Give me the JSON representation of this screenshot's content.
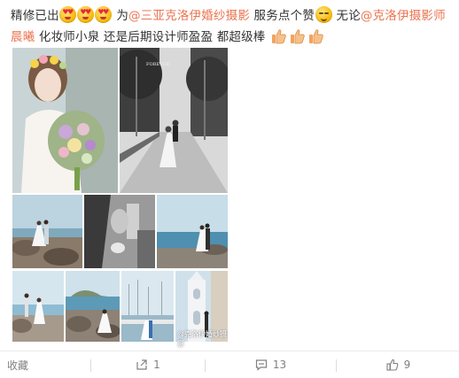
{
  "post": {
    "t1": "精修已出",
    "t2": "为",
    "mention1": "@三亚克洛伊婚纱摄影",
    "t3": "服务点个赞",
    "t4": "无论",
    "mention2": "@克洛伊摄影师晨曦",
    "t5": "化妆师小泉 还是后期设计师盈盈 都超级棒"
  },
  "icons": {
    "emoji": "heart-eyes-emoji",
    "smug": "smug-face-emoji",
    "thumb": "thumbs-up-emoji"
  },
  "watermark": "@克洛伊婚纱摄影",
  "actions": {
    "favorite_label": "收藏",
    "repost_count": "1",
    "comment_count": "13",
    "like_count": "9"
  },
  "colors": {
    "mention": "#eb7350",
    "action_text": "#808080"
  }
}
